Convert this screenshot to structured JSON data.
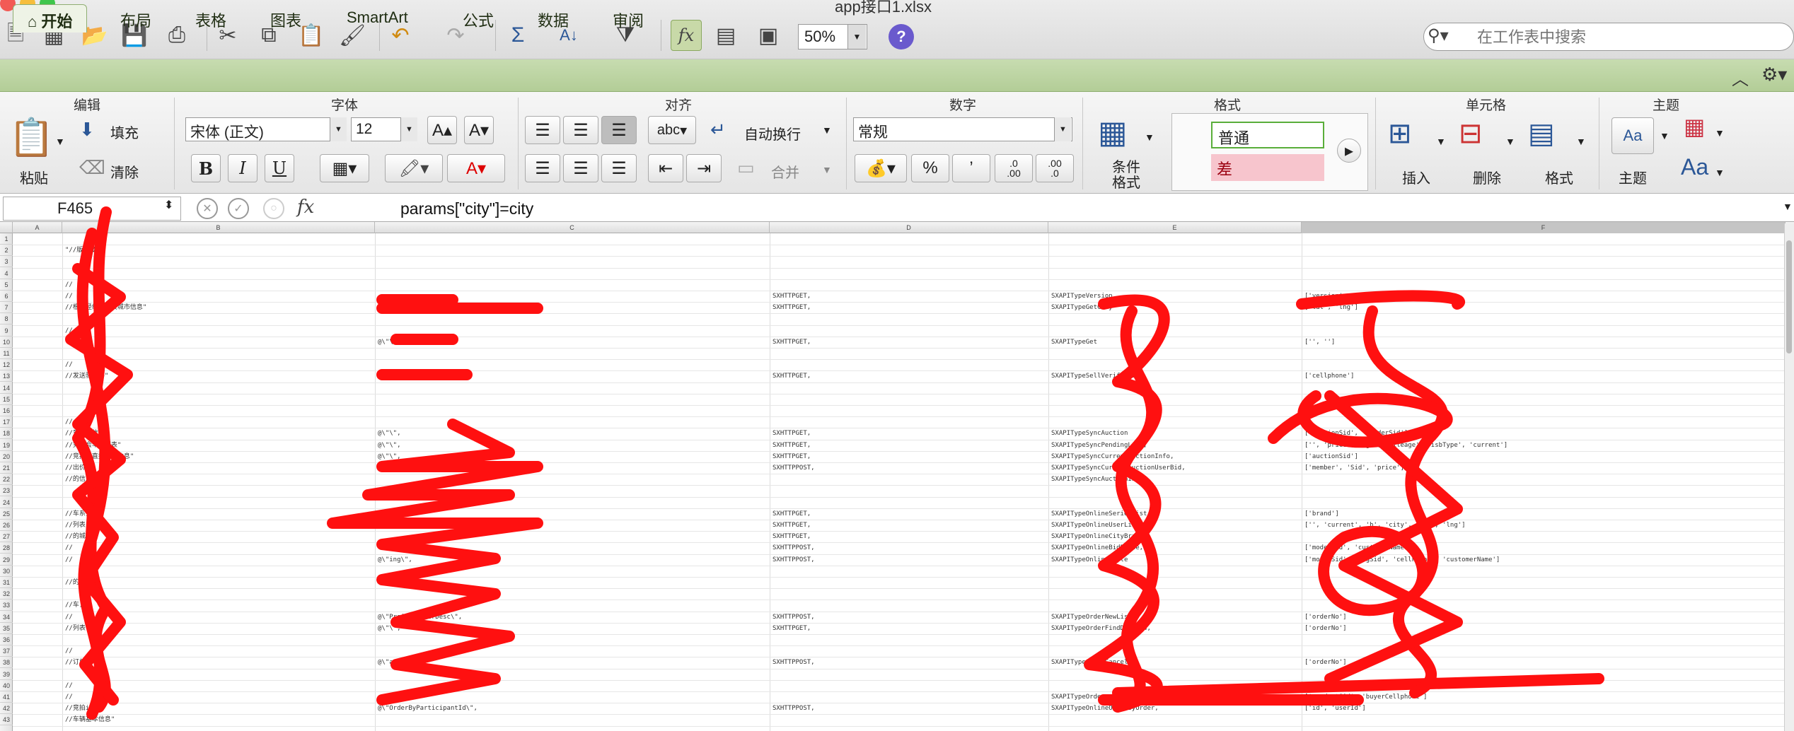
{
  "window": {
    "title": "app接口1.xlsx"
  },
  "toolbar": {
    "zoom": "50%",
    "search_placeholder": "在工作表中搜索"
  },
  "tabs": [
    "开始",
    "布局",
    "表格",
    "图表",
    "SmartArt",
    "公式",
    "数据",
    "审阅"
  ],
  "ribbon": {
    "groups": {
      "edit": "编辑",
      "font": "字体",
      "align": "对齐",
      "number": "数字",
      "format": "格式",
      "cells": "单元格",
      "theme": "主题"
    },
    "paste": "粘贴",
    "fill": "填充",
    "clear": "清除",
    "font_name": "宋体 (正文)",
    "font_size": "12",
    "wrap": "自动换行",
    "merge": "合并",
    "number_format": "常规",
    "cond_format": "条件\n格式",
    "style_normal": "普通",
    "style_bad": "差",
    "insert": "插入",
    "delete": "删除",
    "format_btn": "格式",
    "theme_btn": "主题",
    "bold": "B",
    "italic": "I",
    "underline": "U",
    "percent": "%",
    "comma": "’",
    "dec_inc": ".0\n.00",
    "dec_dec": ".00\n.0",
    "wrap_abc": "abc"
  },
  "formula_bar": {
    "cell_ref": "F465",
    "formula": "params[\"city\"]=city"
  },
  "columns": [
    "A",
    "B",
    "C",
    "D",
    "E",
    "F"
  ],
  "rows": [
    "1",
    "2",
    "3",
    "4",
    "5",
    "6",
    "7",
    "8",
    "9",
    "10",
    "11",
    "12",
    "13",
    "14",
    "15",
    "16",
    "17",
    "18",
    "19",
    "20",
    "21",
    "22",
    "23",
    "24",
    "25",
    "26",
    "27",
    "28",
    "29",
    "30",
    "31",
    "32",
    "33",
    "34",
    "35",
    "36",
    "37",
    "38",
    "39",
    "40",
    "41",
    "42",
    "43"
  ],
  "cells": {
    "b2": "\"//版本接口\"",
    "b5": "//",
    "b6": "//",
    "b7": "//根据经纬度相关城市信息\"",
    "b9": "//",
    "b12": "//",
    "b13": "//发送验证码\"",
    "b17": "//",
    "b18": "//竞拍会信息\"",
    "b19": "//竞拍会车辆列表\"",
    "b20": "//竞拍会直播竞价信息\"",
    "b21": "//出价\"",
    "b22": "//的信息\"",
    "b25": "//车系列表\"",
    "b26": "//列表\"",
    "b27": "//的城市\"",
    "b28": "//",
    "b29": "//",
    "b31": "//的\"",
    "b33": "//车)\"",
    "b34": "//",
    "b35": "//列表\"",
    "b37": "//",
    "b38": "//订单\"",
    "b40": "//",
    "b41": "//",
    "b42": "//竞拍id\"",
    "b43": "//车辆基本信息\"",
    "c7": "@\\\"\\\",",
    "c10": "@\\\"\\\",",
    "c13": "@\\\"\\\",",
    "c18": "@\\\"\\\",",
    "c19": "@\\\"\\\",",
    "c20": "@\\\"\\\",",
    "c26": "@\\\"cityBrand\\\",",
    "c29": "@\\\"ing\\\",",
    "c34": "@\\\"ProjectOrderDesc\\\",",
    "c35": "@\\\"\\\",",
    "c38": "@\\\"ance\\\",",
    "c42": "@\\\"OrderByParticipantId\\\",",
    "d6": "SXHTTPGET,",
    "d7": "SXHTTPGET,",
    "d10": "SXHTTPGET,",
    "d13": "SXHTTPGET,",
    "d18": "SXHTTPGET,",
    "d19": "SXHTTPGET,",
    "d20": "SXHTTPGET,",
    "d21": "SXHTTPPOST,",
    "d25": "SXHTTPGET,",
    "d26": "SXHTTPGET,",
    "d27": "SXHTTPGET,",
    "d28": "SXHTTPPOST,",
    "d29": "SXHTTPPOST,",
    "d34": "SXHTTPPOST,",
    "d35": "SXHTTPGET,",
    "d38": "SXHTTPPOST,",
    "d42": "SXHTTPPOST,",
    "e6": "SXAPITypeVersion",
    "e7": "SXAPITypeGetCity",
    "e10": "SXAPITypeGet",
    "e13": "SXAPITypeSellVerifyCode",
    "e18": "SXAPITypeSyncAuction",
    "e19": "SXAPITypeSyncPendingList,",
    "e20": "SXAPITypeSyncCurrentAuctionInfo,",
    "e21": "SXAPITypeSyncCurrentAuctionUserBid,",
    "e22": "SXAPITypeSyncAuctionInfo",
    "e25": "SXAPITypeOnlineSeriesList,",
    "e26": "SXAPITypeOnlineUserList,",
    "e27": "SXAPITypeOnlineCityBrand,",
    "e28": "SXAPITypeOnlineBidPrice,",
    "e29": "SXAPITypeOnlineStyle",
    "e34": "SXAPITypeOrderNewList",
    "e35": "SXAPITypeOrderFindDeallow,",
    "e38": "SXAPITypeOrderCancel,",
    "e41": "SXAPITypeOrder",
    "e42": "SXAPITypeOnlineOrderByOrder,",
    "f6": "['version', 'versionNo']",
    "f7": "['lat', 'lng']",
    "f10": "['', '']",
    "f13": "['cellphone']",
    "f18": "['auctionSid', 'bidderSid']",
    "f19": "['', 'price', 'age', 'mileage', 'isbType', 'current']",
    "f20": "['auctionSid']",
    "f21": "['member', 'Sid', 'price']",
    "f25": "['brand']",
    "f26": "['', 'current', 'h', 'city', 'lat', 'lng']",
    "f28": "['modelSid', 'customerName']",
    "f29": "['modelSid', 'orgSid', 'cellPhone', 'customerName']",
    "f34": "['orderNo']",
    "f35": "['orderNo']",
    "f38": "['orderNo']",
    "f41": "['productSid', 'buyerCellphone']",
    "f42": "['id', 'userId']"
  },
  "colors": {
    "ribbon_tab": "#b3cd97",
    "scribble": "#ff0000",
    "style_bad": "#f7c5cd",
    "style_normal_border": "#5aae3a"
  }
}
